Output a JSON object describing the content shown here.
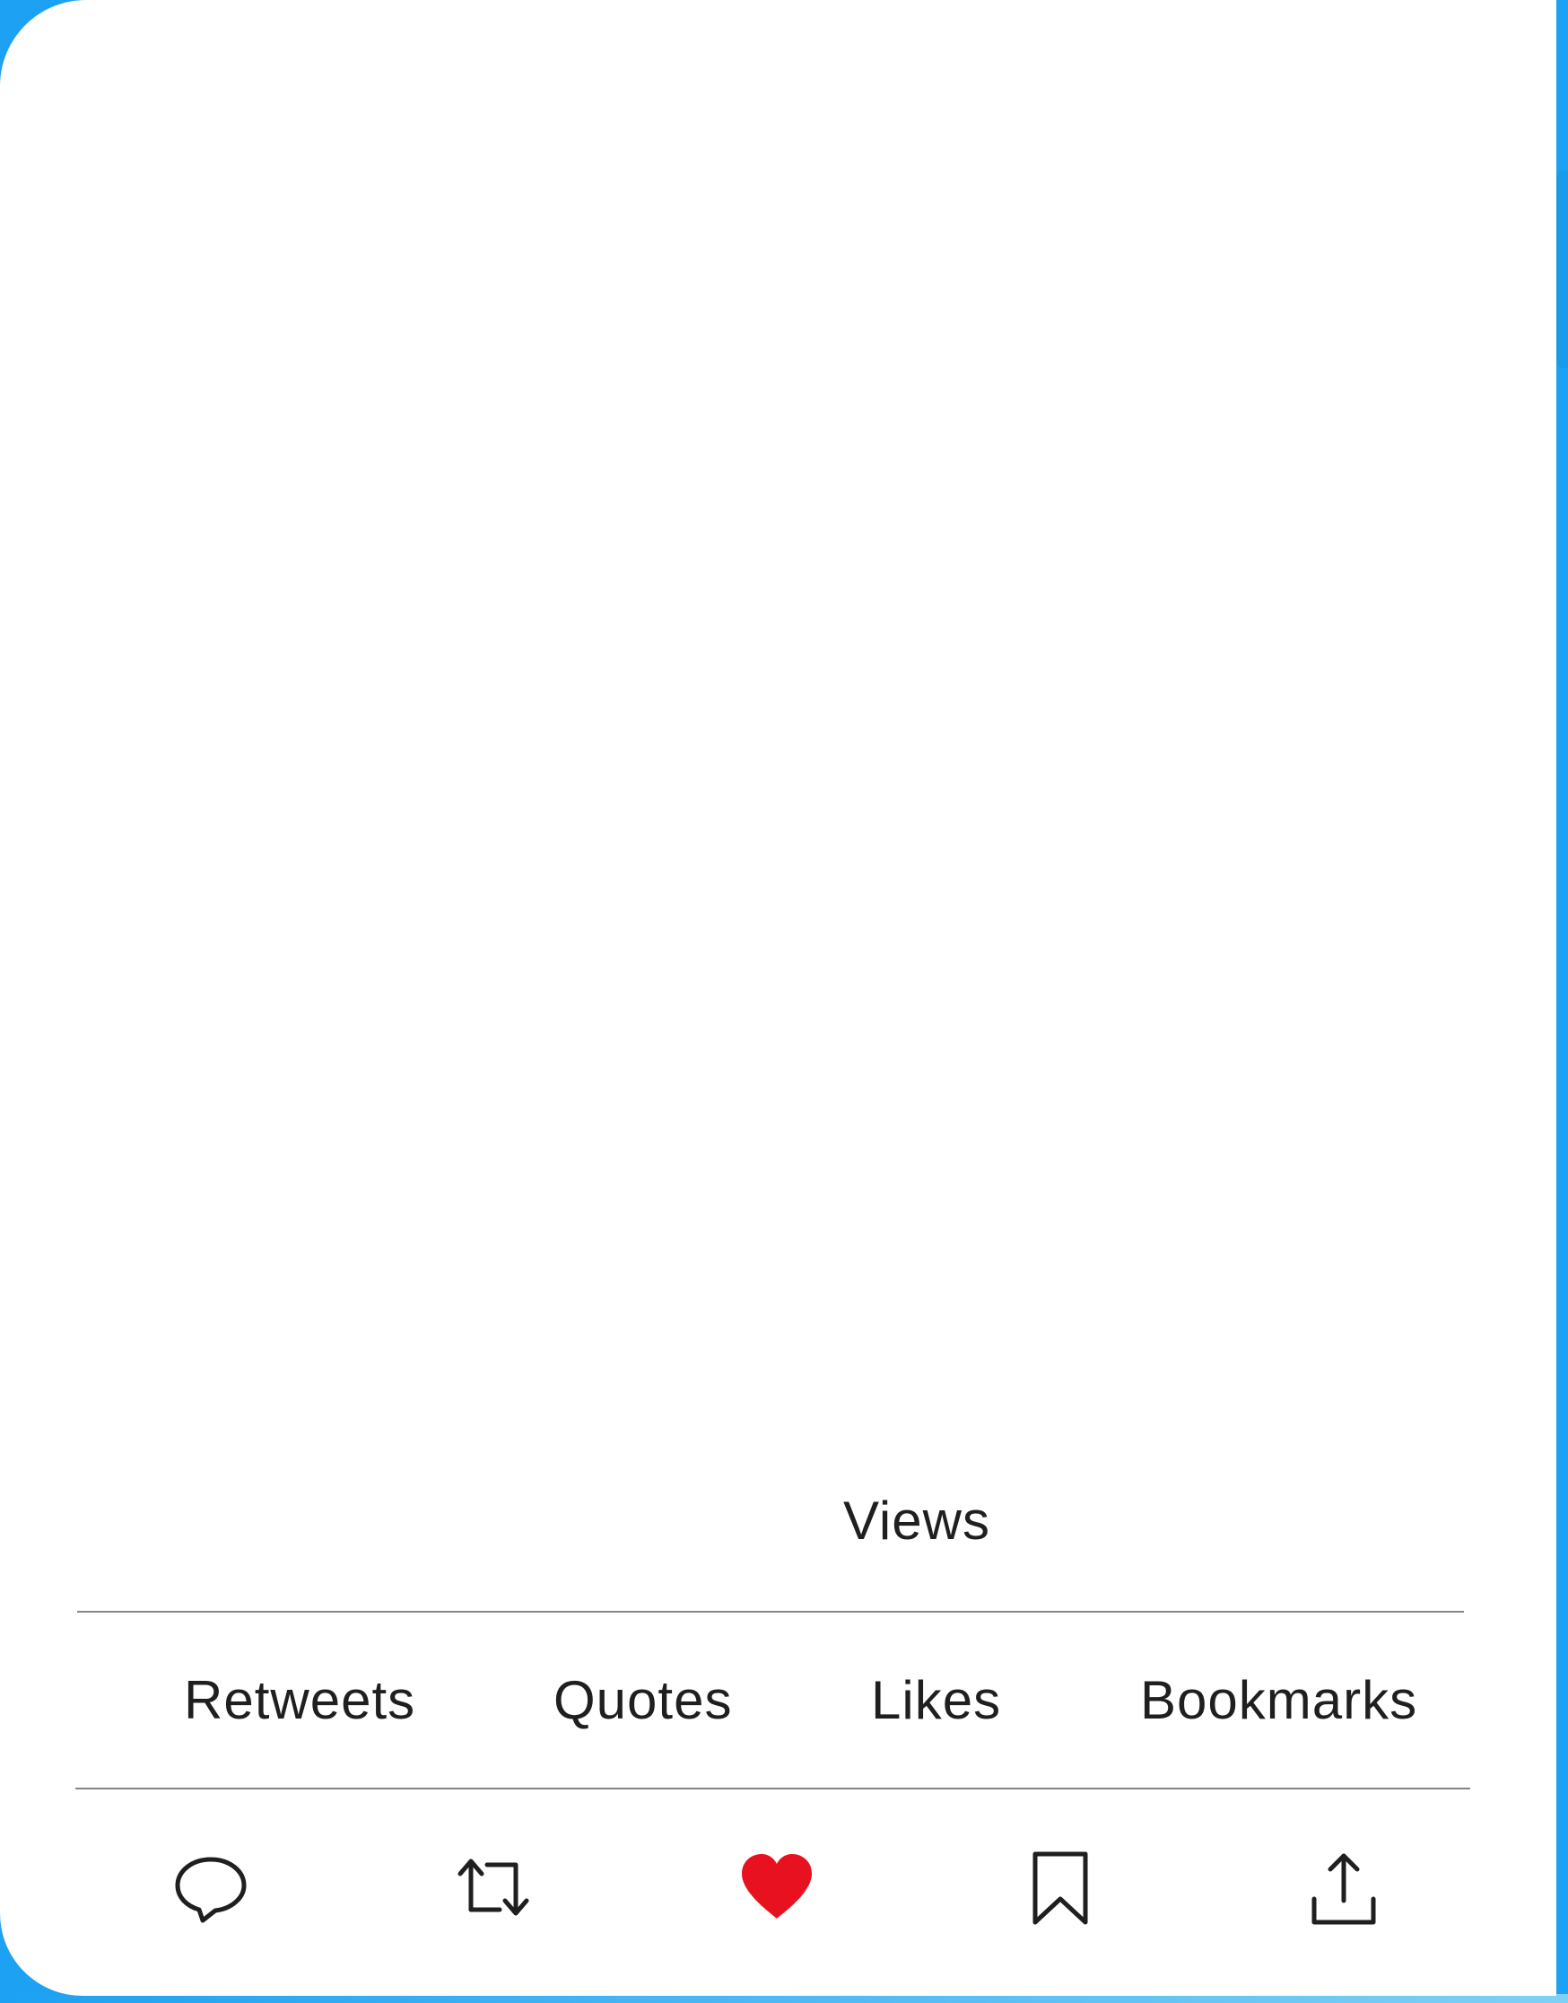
{
  "tweet": {
    "views_label": "Views"
  },
  "stats": {
    "retweets_label": "Retweets",
    "quotes_label": "Quotes",
    "likes_label": "Likes",
    "bookmarks_label": "Bookmarks"
  },
  "actions": {
    "reply_icon": "speech-bubble-icon",
    "retweet_icon": "retweet-arrows-icon",
    "like_icon": "heart-icon",
    "like_active": true,
    "bookmark_icon": "bookmark-icon",
    "share_icon": "share-upload-icon"
  },
  "colors": {
    "accent": "#1da1f2",
    "like": "#e8111f",
    "text": "#1f1f1f",
    "divider": "#8a8580"
  }
}
